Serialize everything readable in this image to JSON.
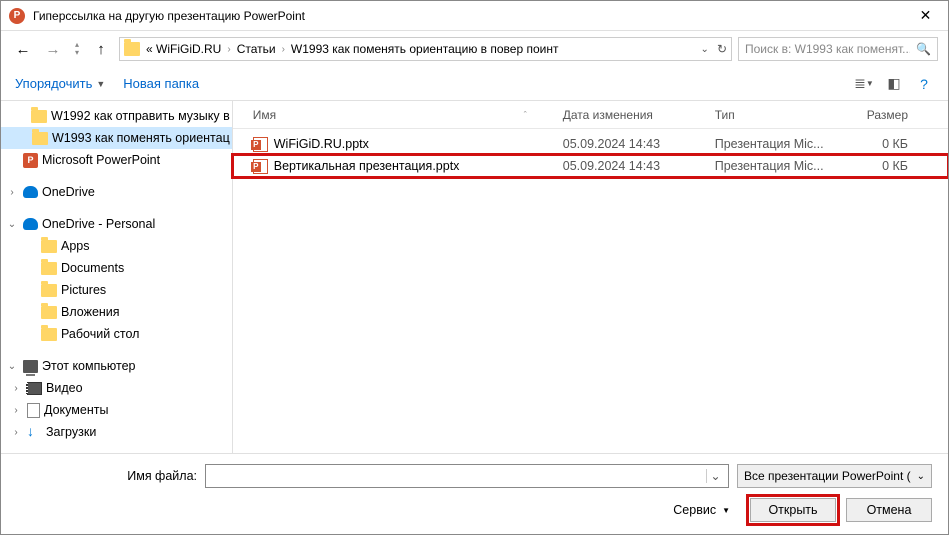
{
  "title": "Гиперссылка на другую презентацию PowerPoint",
  "address": {
    "root": "« WiFiGiD.RU",
    "seg1": "Статьи",
    "seg2": "W1993 как поменять ориентацию в повер поинт"
  },
  "search": {
    "placeholder": "Поиск в: W1993 как поменят..."
  },
  "toolbar": {
    "organize": "Упорядочить",
    "newfolder": "Новая папка"
  },
  "sidebar": {
    "items": [
      {
        "label": "W1992 как отправить музыку в"
      },
      {
        "label": "W1993 как поменять ориентац"
      },
      {
        "label": "Microsoft PowerPoint"
      },
      {
        "label": "OneDrive"
      },
      {
        "label": "OneDrive - Personal"
      },
      {
        "label": "Apps"
      },
      {
        "label": "Documents"
      },
      {
        "label": "Pictures"
      },
      {
        "label": "Вложения"
      },
      {
        "label": "Рабочий стол"
      },
      {
        "label": "Этот компьютер"
      },
      {
        "label": "Видео"
      },
      {
        "label": "Документы"
      },
      {
        "label": "Загрузки"
      }
    ]
  },
  "columns": {
    "name": "Имя",
    "date": "Дата изменения",
    "type": "Тип",
    "size": "Размер"
  },
  "files": [
    {
      "name": "WiFiGiD.RU.pptx",
      "date": "05.09.2024 14:43",
      "type": "Презентация Mic...",
      "size": "0 КБ"
    },
    {
      "name": "Вертикальная презентация.pptx",
      "date": "05.09.2024 14:43",
      "type": "Презентация Mic...",
      "size": "0 КБ"
    }
  ],
  "footer": {
    "fn_label": "Имя файла:",
    "filter": "Все презентации PowerPoint (",
    "service": "Сервис",
    "open": "Открыть",
    "cancel": "Отмена"
  }
}
